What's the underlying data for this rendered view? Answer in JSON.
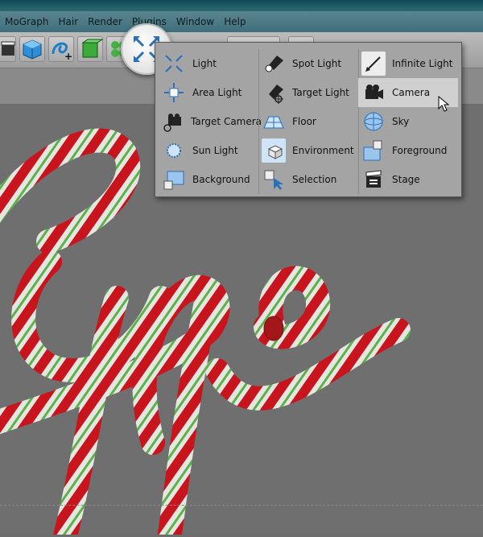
{
  "menu": [
    "MoGraph",
    "Hair",
    "Render",
    "Plugins",
    "Window",
    "Help"
  ],
  "toolbar": {
    "icons": [
      "film-clapper-icon",
      "cube-icon",
      "spline-pen-icon",
      "nurbs-cube-icon",
      "mograph-cloner-icon",
      "light-tool-icon",
      "render-icon",
      "scene-icon"
    ]
  },
  "light_menu": {
    "columns": [
      [
        {
          "label": "Light",
          "icon": "omni-light-icon"
        },
        {
          "label": "Area Light",
          "icon": "area-light-icon"
        },
        {
          "label": "Target Camera",
          "icon": "target-camera-icon"
        },
        {
          "label": "Sun Light",
          "icon": "sun-light-icon"
        },
        {
          "label": "Background",
          "icon": "background-icon"
        }
      ],
      [
        {
          "label": "Spot Light",
          "icon": "spot-light-icon"
        },
        {
          "label": "Target Light",
          "icon": "target-light-icon"
        },
        {
          "label": "Floor",
          "icon": "floor-icon"
        },
        {
          "label": "Environment",
          "icon": "environment-icon"
        },
        {
          "label": "Selection",
          "icon": "selection-icon"
        }
      ],
      [
        {
          "label": "Infinite Light",
          "icon": "infinite-light-icon"
        },
        {
          "label": "Camera",
          "icon": "camera-icon",
          "highlighted": true
        },
        {
          "label": "Sky",
          "icon": "sky-icon"
        },
        {
          "label": "Foreground",
          "icon": "foreground-icon"
        },
        {
          "label": "Stage",
          "icon": "stage-icon"
        }
      ]
    ]
  },
  "colors": {
    "cane_red": "#c8141c",
    "cane_white": "#e6e6e0",
    "cane_green": "#5bb24a",
    "viewport": "#6f6f6f"
  }
}
